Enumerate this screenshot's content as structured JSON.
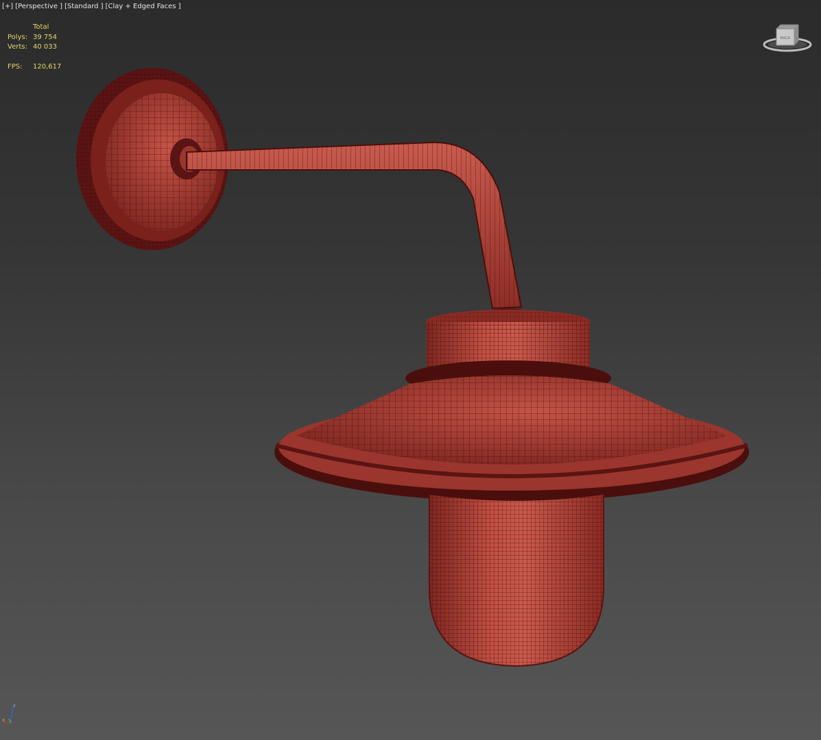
{
  "viewport": {
    "labels": [
      "[+]",
      "[Perspective ]",
      "[Standard ]",
      "[Clay + Edged Faces ]"
    ]
  },
  "stats": {
    "header": "Total",
    "polys_label": "Polys:",
    "polys_value": "39 754",
    "verts_label": "Verts:",
    "verts_value": "40 033",
    "fps_label": "FPS:",
    "fps_value": "120,617"
  },
  "viewcube": {
    "face_label": "BACK",
    "icon": "viewcube-icon"
  },
  "axis_gizmo": {
    "icon": "axis-tripod-icon",
    "z_label": "z",
    "x_label": "x"
  },
  "colors": {
    "clay_base": "#b8453b",
    "clay_dark": "#5a1413",
    "wire_edge": "#3a0807",
    "stats_text": "#e7d56c",
    "label_text": "#e6e6e6"
  }
}
